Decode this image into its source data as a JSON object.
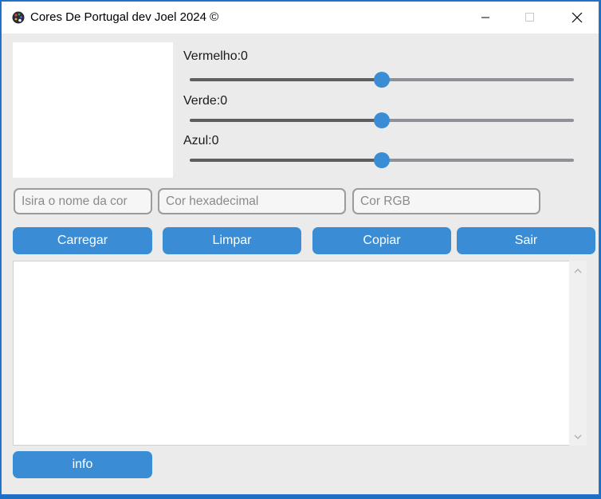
{
  "window": {
    "title": "Cores De Portugal dev Joel 2024 ©",
    "icon": "palette-icon",
    "controls": [
      "minimize-icon",
      "maximize-icon",
      "close-icon"
    ]
  },
  "sliders": [
    {
      "label": "Vermelho:0",
      "value": 0,
      "color": "#ff0000"
    },
    {
      "label": "Verde:0",
      "value": 0,
      "color": "#00ff00"
    },
    {
      "label": "Azul:0",
      "value": 0,
      "color": "#0000ff"
    }
  ],
  "inputs": {
    "name_placeholder": "Isira o nome da cor",
    "hex_placeholder": "Cor hexadecimal",
    "rgb_placeholder": "Cor RGB"
  },
  "buttons": {
    "load": "Carregar",
    "clear": "Limpar",
    "copy": "Copiar",
    "exit": "Sair",
    "info": "info"
  },
  "output": {
    "text": ""
  },
  "colors": {
    "accent": "#3a8dd4",
    "background": "#ebebeb"
  }
}
